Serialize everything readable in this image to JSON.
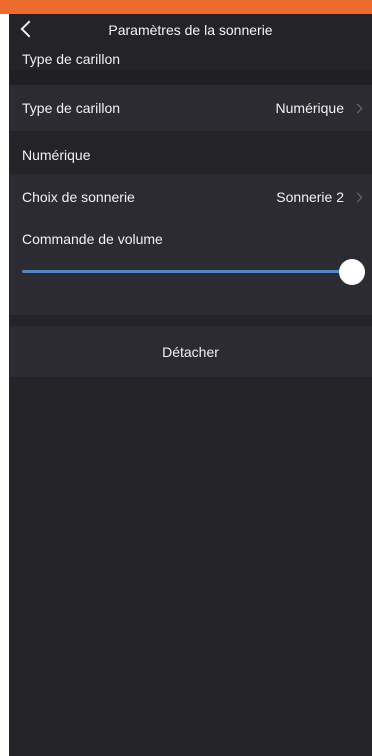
{
  "header": {
    "title": "Paramètres de la sonnerie"
  },
  "sections": {
    "chime_type_heading": "Type de carillon",
    "digital_heading": "Numérique"
  },
  "rows": {
    "chime_type": {
      "label": "Type de carillon",
      "value": "Numérique"
    },
    "ringtone": {
      "label": "Choix de sonnerie",
      "value": "Sonnerie 2"
    }
  },
  "volume": {
    "label": "Commande de volume",
    "level_percent": 100
  },
  "actions": {
    "detach_label": "Détacher"
  },
  "colors": {
    "accent_strip": "#ec6b2d",
    "background": "#232328",
    "slider_fill": "#4f86c6"
  },
  "icons": {
    "back": "chevron-left-icon",
    "row_arrow": "chevron-right-icon"
  }
}
